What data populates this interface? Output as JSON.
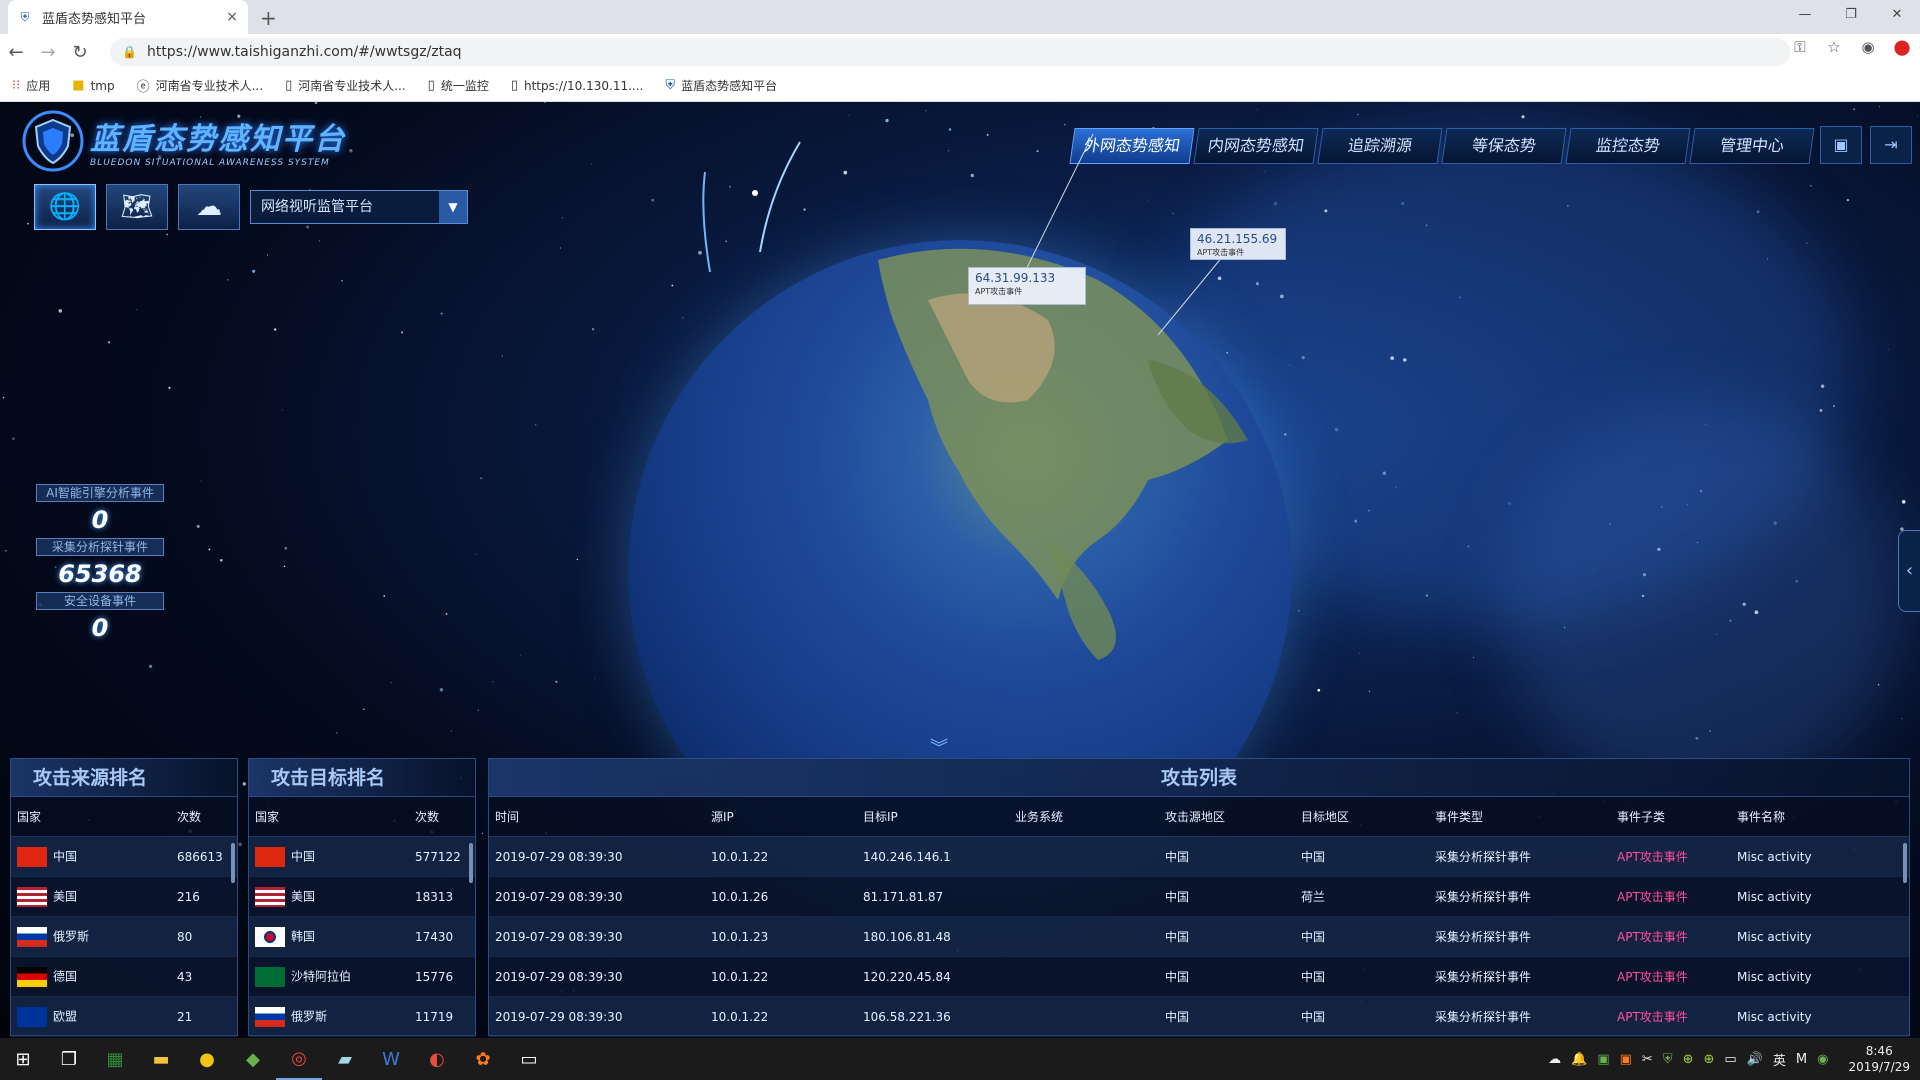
{
  "browser": {
    "tab_title": "蓝盾态势感知平台",
    "tab_close": "×",
    "new_tab": "+",
    "win_min": "—",
    "win_max": "❐",
    "win_close": "✕",
    "url": "https://www.taishiganzhi.com/#/wwtsgz/ztaq",
    "bookmarks": [
      {
        "icon": "apps-icon",
        "label": "应用"
      },
      {
        "icon": "folder-icon",
        "label": "tmp"
      },
      {
        "icon": "e-icon",
        "label": "河南省专业技术人..."
      },
      {
        "icon": "page-icon",
        "label": "河南省专业技术人..."
      },
      {
        "icon": "page-icon",
        "label": "统一监控"
      },
      {
        "icon": "page-icon",
        "label": "https://10.130.11...."
      },
      {
        "icon": "shield-icon",
        "label": "蓝盾态势感知平台"
      }
    ]
  },
  "app": {
    "logo_title": "蓝盾态势感知平台",
    "logo_subtitle": "BLUEDON SITUATIONAL AWARENESS SYSTEM",
    "nav": [
      "外网态势感知",
      "内网态势感知",
      "追踪溯源",
      "等保态势",
      "监控态势",
      "管理中心"
    ],
    "nav_active": "外网态势感知",
    "platform_select": "网络视听监管平台",
    "stats": [
      {
        "label": "AI智能引擎分析事件",
        "value": "0"
      },
      {
        "label": "采集分析探针事件",
        "value": "65368"
      },
      {
        "label": "安全设备事件",
        "value": "0"
      }
    ],
    "callouts": [
      {
        "ip": "64.31.99.133",
        "type": "APT攻击事件"
      },
      {
        "ip": "46.21.155.69",
        "type": "APT攻击事件"
      }
    ]
  },
  "source_rank": {
    "title": "攻击来源排名",
    "headers": [
      "国家",
      "次数"
    ],
    "rows": [
      {
        "country": "中国",
        "count": "686613",
        "flag": "cn"
      },
      {
        "country": "美国",
        "count": "216",
        "flag": "us"
      },
      {
        "country": "俄罗斯",
        "count": "80",
        "flag": "ru"
      },
      {
        "country": "德国",
        "count": "43",
        "flag": "de"
      },
      {
        "country": "欧盟",
        "count": "21",
        "flag": "eu"
      }
    ]
  },
  "target_rank": {
    "title": "攻击目标排名",
    "headers": [
      "国家",
      "次数"
    ],
    "rows": [
      {
        "country": "中国",
        "count": "577122",
        "flag": "cn"
      },
      {
        "country": "美国",
        "count": "18313",
        "flag": "us"
      },
      {
        "country": "韩国",
        "count": "17430",
        "flag": "kr"
      },
      {
        "country": "沙特阿拉伯",
        "count": "15776",
        "flag": "sa"
      },
      {
        "country": "俄罗斯",
        "count": "11719",
        "flag": "ru"
      }
    ]
  },
  "attack_list": {
    "title": "攻击列表",
    "headers": [
      "时间",
      "源IP",
      "目标IP",
      "业务系统",
      "攻击源地区",
      "目标地区",
      "事件类型",
      "事件子类",
      "事件名称"
    ],
    "rows": [
      [
        "2019-07-29 08:39:30",
        "10.0.1.22",
        "140.246.146.1",
        "",
        "中国",
        "中国",
        "采集分析探针事件",
        "APT攻击事件",
        "Misc activity"
      ],
      [
        "2019-07-29 08:39:30",
        "10.0.1.26",
        "81.171.81.87",
        "",
        "中国",
        "荷兰",
        "采集分析探针事件",
        "APT攻击事件",
        "Misc activity"
      ],
      [
        "2019-07-29 08:39:30",
        "10.0.1.23",
        "180.106.81.48",
        "",
        "中国",
        "中国",
        "采集分析探针事件",
        "APT攻击事件",
        "Misc activity"
      ],
      [
        "2019-07-29 08:39:30",
        "10.0.1.22",
        "120.220.45.84",
        "",
        "中国",
        "中国",
        "采集分析探针事件",
        "APT攻击事件",
        "Misc activity"
      ],
      [
        "2019-07-29 08:39:30",
        "10.0.1.22",
        "106.58.221.36",
        "",
        "中国",
        "中国",
        "采集分析探针事件",
        "APT攻击事件",
        "Misc activity"
      ]
    ]
  },
  "taskbar": {
    "time": "8:46",
    "date": "2019/7/29",
    "ime": "英",
    "ime2": "M"
  }
}
